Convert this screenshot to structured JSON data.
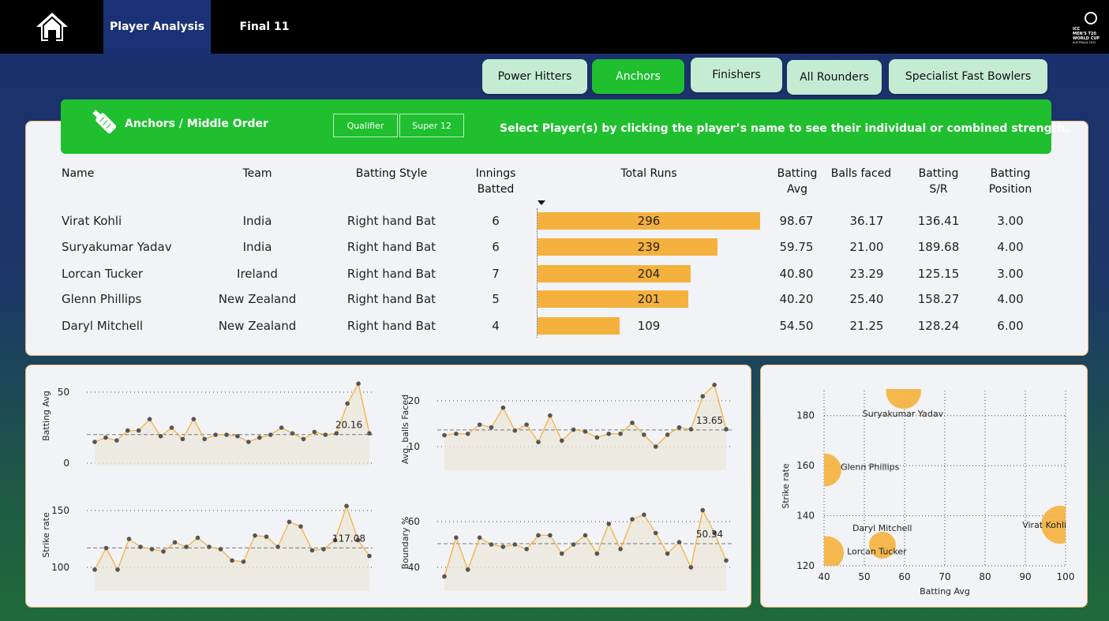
{
  "nav": {
    "home_icon": "home-icon",
    "tabs": [
      {
        "label": "Player Analysis",
        "active": true
      },
      {
        "label": "Final 11",
        "active": false
      }
    ],
    "logo_text": [
      "ICC",
      "MEN'S T20",
      "WORLD CUP",
      "AUSTRALIA 2022"
    ]
  },
  "categories": [
    "Power Hitters",
    "Anchors",
    "Finishers",
    "All Rounders",
    "Specialist Fast Bowlers"
  ],
  "active_category": "Anchors",
  "banner": {
    "icon": "cricket-bat-icon",
    "title": "Anchors / Middle Order",
    "filters": [
      "Qualifier",
      "Super 12"
    ],
    "message": "Select Player(s) by clicking the player’s name to see their individual or combined strength."
  },
  "table": {
    "headers": {
      "name": "Name",
      "team": "Team",
      "style": "Batting Style",
      "innings_1": "Innings",
      "innings_2": "Batted",
      "runs": "Total Runs",
      "avg_1": "Batting",
      "avg_2": "Avg",
      "balls": "Balls faced",
      "sr_1": "Batting",
      "sr_2": "S/R",
      "pos_1": "Batting",
      "pos_2": "Position"
    },
    "sort_icon": "sort-desc-icon",
    "rows": [
      {
        "name": "Virat Kohli",
        "team": "India",
        "style": "Right hand Bat",
        "innings": "6",
        "runs": 296,
        "avg": "98.67",
        "balls": "36.17",
        "sr": "136.41",
        "pos": "3.00"
      },
      {
        "name": "Suryakumar Yadav",
        "team": "India",
        "style": "Right hand Bat",
        "innings": "6",
        "runs": 239,
        "avg": "59.75",
        "balls": "21.00",
        "sr": "189.68",
        "pos": "4.00"
      },
      {
        "name": "Lorcan Tucker",
        "team": "Ireland",
        "style": "Right hand Bat",
        "innings": "7",
        "runs": 204,
        "avg": "40.80",
        "balls": "23.29",
        "sr": "125.15",
        "pos": "3.00"
      },
      {
        "name": "Glenn Phillips",
        "team": "New Zealand",
        "style": "Right hand Bat",
        "innings": "5",
        "runs": 201,
        "avg": "40.20",
        "balls": "25.40",
        "sr": "158.27",
        "pos": "4.00"
      },
      {
        "name": "Daryl Mitchell",
        "team": "New Zealand",
        "style": "Right hand Bat",
        "innings": "4",
        "runs": 109,
        "avg": "54.50",
        "balls": "21.25",
        "sr": "128.24",
        "pos": "6.00"
      }
    ],
    "runs_max": 296
  },
  "colors": {
    "accent_green": "#1fbf2f",
    "pill_green": "#c4ecd2",
    "bar_orange": "#f5b13d",
    "nav_active": "#1a3176"
  },
  "chart_data": [
    {
      "type": "line",
      "ylabel": "Batting Avg",
      "ylim": [
        0,
        60
      ],
      "ticks": [
        0,
        50
      ],
      "avg_label": "20.16",
      "avg_value": 20.16,
      "values": [
        15,
        18,
        16,
        23,
        23,
        31,
        19,
        25,
        17,
        31,
        17,
        20,
        20,
        19,
        15,
        18,
        20,
        25,
        21,
        17,
        22,
        20,
        21,
        42,
        56,
        21
      ]
    },
    {
      "type": "line",
      "ylabel": "Avg. balls Faced",
      "ylim": [
        5,
        25
      ],
      "ticks": [
        10,
        20
      ],
      "avg_label": "13.65",
      "avg_value": 13.65,
      "values": [
        12.5,
        12.8,
        12.8,
        14.8,
        14.2,
        18.5,
        13.5,
        14.8,
        11,
        16.8,
        11.3,
        13.7,
        13.3,
        12,
        12.8,
        12.8,
        15.2,
        12.6,
        10,
        12.6,
        14.2,
        13.8,
        21,
        23.5,
        13.8
      ]
    },
    {
      "type": "line",
      "ylabel": "Strike rate",
      "ylim": [
        92,
        158
      ],
      "ticks": [
        100,
        150
      ],
      "avg_label": "117.08",
      "avg_value": 117.08,
      "values": [
        98,
        117,
        98,
        125,
        118,
        116,
        114,
        122,
        118,
        126,
        118,
        116,
        106,
        105,
        128,
        127,
        118,
        140,
        136,
        115,
        116,
        124,
        154,
        124,
        110
      ]
    },
    {
      "type": "line",
      "ylabel": "Boundary %",
      "ylim": [
        30,
        70
      ],
      "ticks": [
        40,
        60
      ],
      "avg_label": "50.34",
      "avg_value": 50.34,
      "values": [
        36,
        53,
        39,
        53,
        50,
        49,
        50,
        48,
        54,
        54,
        46,
        50,
        54,
        46,
        59,
        48,
        61,
        63,
        55,
        46,
        51,
        40,
        65,
        55,
        43
      ]
    },
    {
      "type": "scatter",
      "xlabel": "Batting Avg",
      "ylabel": "Strike rate",
      "xlim": [
        40,
        100
      ],
      "ylim": [
        120,
        190
      ],
      "xticks": [
        40,
        50,
        60,
        70,
        80,
        90,
        100
      ],
      "yticks": [
        120,
        140,
        160,
        180
      ],
      "points": [
        {
          "label": "Virat Kohli",
          "x": 98.67,
          "y": 136.41,
          "size": 296
        },
        {
          "label": "Suryakumar Yadav",
          "x": 59.75,
          "y": 189.68,
          "size": 239
        },
        {
          "label": "Lorcan Tucker",
          "x": 40.8,
          "y": 125.15,
          "size": 204
        },
        {
          "label": "Glenn Phillips",
          "x": 40.2,
          "y": 158.27,
          "size": 201
        },
        {
          "label": "Daryl Mitchell",
          "x": 54.5,
          "y": 128.24,
          "size": 109
        }
      ]
    }
  ]
}
